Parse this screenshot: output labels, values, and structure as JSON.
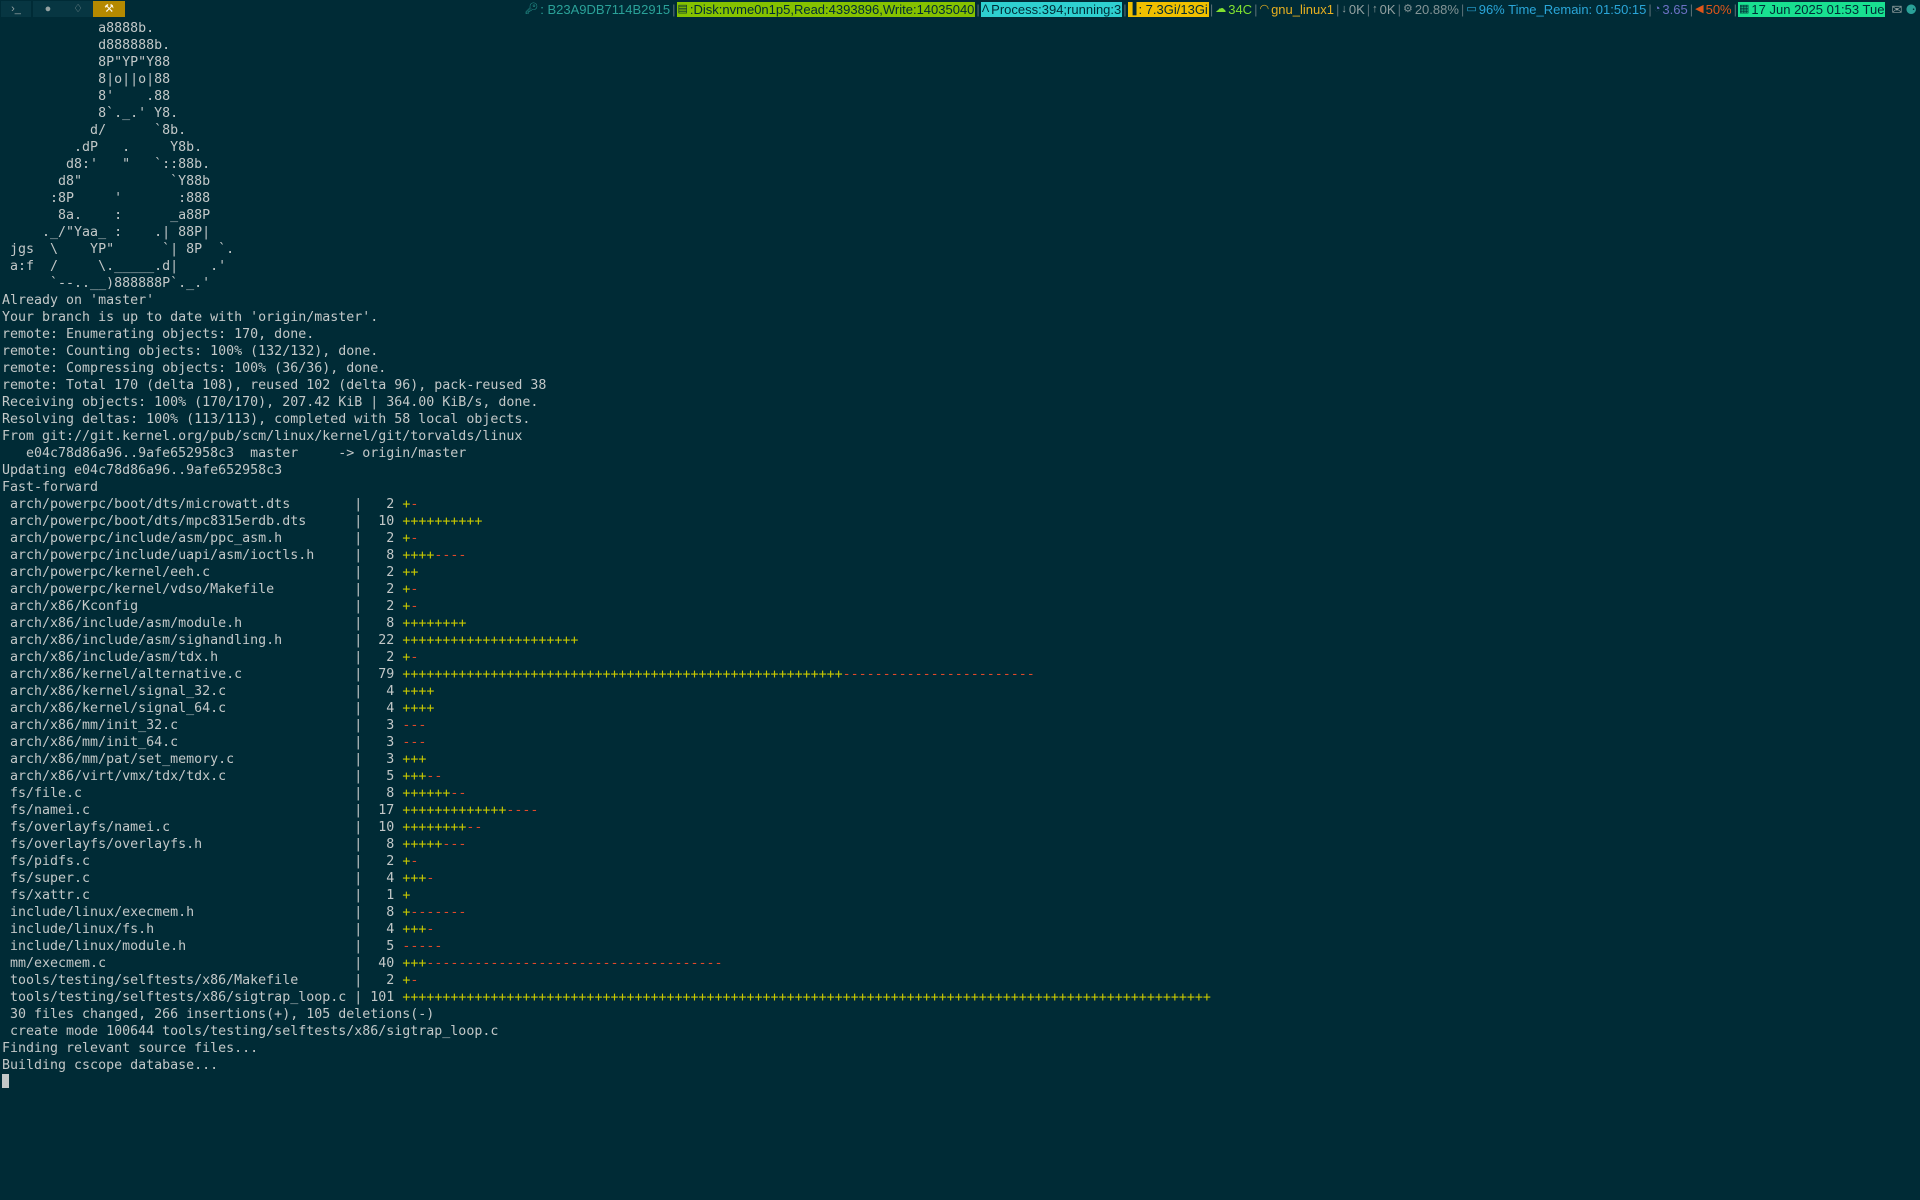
{
  "topbar": {
    "workspaces": [
      {
        "label": "›_",
        "icon": "terminal-icon"
      },
      {
        "label": "●",
        "icon": "firefox-icon"
      },
      {
        "label": "♢",
        "icon": "linux-icon"
      },
      {
        "label": "⚒",
        "icon": "tools-icon",
        "active": true
      }
    ],
    "status": {
      "key": ": B23A9DB7114B2915",
      "disk": ":Disk:nvme0n1p5,Read:4393896,Write:14035040",
      "process": " Process:394;running:3",
      "memory": ": 7.3Gi/13Gi",
      "temp": "34C",
      "wifi": "gnu_linux1",
      "down": "0K",
      "up": "0K",
      "cpu": "20.88%",
      "battery": "96% Time_Remain: 01:50:15",
      "load": "3.65",
      "volume": "50%",
      "date": "17 Jun 2025 01:53 Tue"
    }
  },
  "ascii_art": [
    "            a8888b.",
    "            d888888b.",
    "            8P\"YP\"Y88",
    "            8|o||o|88",
    "            8'    .88",
    "            8`._.' Y8.",
    "           d/      `8b.",
    "         .dP   .     Y8b.",
    "        d8:'   \"   `::88b.",
    "       d8\"           `Y88b",
    "      :8P     '       :888",
    "       8a.    :      _a88P",
    "     ._/\"Yaa_ :    .| 88P|",
    " jgs  \\    YP\"      `| 8P  `.",
    " a:f  /     \\._____.d|    .'",
    "      `--..__)888888P`._.'"
  ],
  "git_lines": [
    "Already on 'master'",
    "Your branch is up to date with 'origin/master'.",
    "remote: Enumerating objects: 170, done.",
    "remote: Counting objects: 100% (132/132), done.",
    "remote: Compressing objects: 100% (36/36), done.",
    "remote: Total 170 (delta 108), reused 102 (delta 96), pack-reused 38",
    "Receiving objects: 100% (170/170), 207.42 KiB | 364.00 KiB/s, done.",
    "Resolving deltas: 100% (113/113), completed with 58 local objects.",
    "From git://git.kernel.org/pub/scm/linux/kernel/git/torvalds/linux",
    "   e04c78d86a96..9afe652958c3  master     -> origin/master",
    "Updating e04c78d86a96..9afe652958c3",
    "Fast-forward"
  ],
  "diffstat": [
    {
      "file": " arch/powerpc/boot/dts/microwatt.dts        ",
      "count": "  2",
      "plus": "+",
      "minus": "-"
    },
    {
      "file": " arch/powerpc/boot/dts/mpc8315erdb.dts      ",
      "count": " 10",
      "plus": "++++++++++",
      "minus": ""
    },
    {
      "file": " arch/powerpc/include/asm/ppc_asm.h         ",
      "count": "  2",
      "plus": "+",
      "minus": "-"
    },
    {
      "file": " arch/powerpc/include/uapi/asm/ioctls.h     ",
      "count": "  8",
      "plus": "++++",
      "minus": "----"
    },
    {
      "file": " arch/powerpc/kernel/eeh.c                  ",
      "count": "  2",
      "plus": "++",
      "minus": ""
    },
    {
      "file": " arch/powerpc/kernel/vdso/Makefile          ",
      "count": "  2",
      "plus": "+",
      "minus": "-"
    },
    {
      "file": " arch/x86/Kconfig                           ",
      "count": "  2",
      "plus": "+",
      "minus": "-"
    },
    {
      "file": " arch/x86/include/asm/module.h              ",
      "count": "  8",
      "plus": "++++++++",
      "minus": ""
    },
    {
      "file": " arch/x86/include/asm/sighandling.h         ",
      "count": " 22",
      "plus": "++++++++++++++++++++++",
      "minus": ""
    },
    {
      "file": " arch/x86/include/asm/tdx.h                 ",
      "count": "  2",
      "plus": "+",
      "minus": "-"
    },
    {
      "file": " arch/x86/kernel/alternative.c              ",
      "count": " 79",
      "plus": "+++++++++++++++++++++++++++++++++++++++++++++++++++++++",
      "minus": "------------------------"
    },
    {
      "file": " arch/x86/kernel/signal_32.c                ",
      "count": "  4",
      "plus": "++++",
      "minus": ""
    },
    {
      "file": " arch/x86/kernel/signal_64.c                ",
      "count": "  4",
      "plus": "++++",
      "minus": ""
    },
    {
      "file": " arch/x86/mm/init_32.c                      ",
      "count": "  3",
      "plus": "",
      "minus": "---"
    },
    {
      "file": " arch/x86/mm/init_64.c                      ",
      "count": "  3",
      "plus": "",
      "minus": "---"
    },
    {
      "file": " arch/x86/mm/pat/set_memory.c               ",
      "count": "  3",
      "plus": "+++",
      "minus": ""
    },
    {
      "file": " arch/x86/virt/vmx/tdx/tdx.c                ",
      "count": "  5",
      "plus": "+++",
      "minus": "--"
    },
    {
      "file": " fs/file.c                                  ",
      "count": "  8",
      "plus": "++++++",
      "minus": "--"
    },
    {
      "file": " fs/namei.c                                 ",
      "count": " 17",
      "plus": "+++++++++++++",
      "minus": "----"
    },
    {
      "file": " fs/overlayfs/namei.c                       ",
      "count": " 10",
      "plus": "++++++++",
      "minus": "--"
    },
    {
      "file": " fs/overlayfs/overlayfs.h                   ",
      "count": "  8",
      "plus": "+++++",
      "minus": "---"
    },
    {
      "file": " fs/pidfs.c                                 ",
      "count": "  2",
      "plus": "+",
      "minus": "-"
    },
    {
      "file": " fs/super.c                                 ",
      "count": "  4",
      "plus": "+++",
      "minus": "-"
    },
    {
      "file": " fs/xattr.c                                 ",
      "count": "  1",
      "plus": "+",
      "minus": ""
    },
    {
      "file": " include/linux/execmem.h                    ",
      "count": "  8",
      "plus": "+",
      "minus": "-------"
    },
    {
      "file": " include/linux/fs.h                         ",
      "count": "  4",
      "plus": "+++",
      "minus": "-"
    },
    {
      "file": " include/linux/module.h                     ",
      "count": "  5",
      "plus": "",
      "minus": "-----"
    },
    {
      "file": " mm/execmem.c                               ",
      "count": " 40",
      "plus": "+++",
      "minus": "-------------------------------------"
    },
    {
      "file": " tools/testing/selftests/x86/Makefile       ",
      "count": "  2",
      "plus": "+",
      "minus": "-"
    },
    {
      "file": " tools/testing/selftests/x86/sigtrap_loop.c ",
      "count": "101",
      "plus": "+++++++++++++++++++++++++++++++++++++++++++++++++++++++++++++++++++++++++++++++++++++++++++++++++++++",
      "minus": ""
    }
  ],
  "summary_lines": [
    " 30 files changed, 266 insertions(+), 105 deletions(-)",
    " create mode 100644 tools/testing/selftests/x86/sigtrap_loop.c",
    "Finding relevant source files...",
    "Building cscope database..."
  ]
}
